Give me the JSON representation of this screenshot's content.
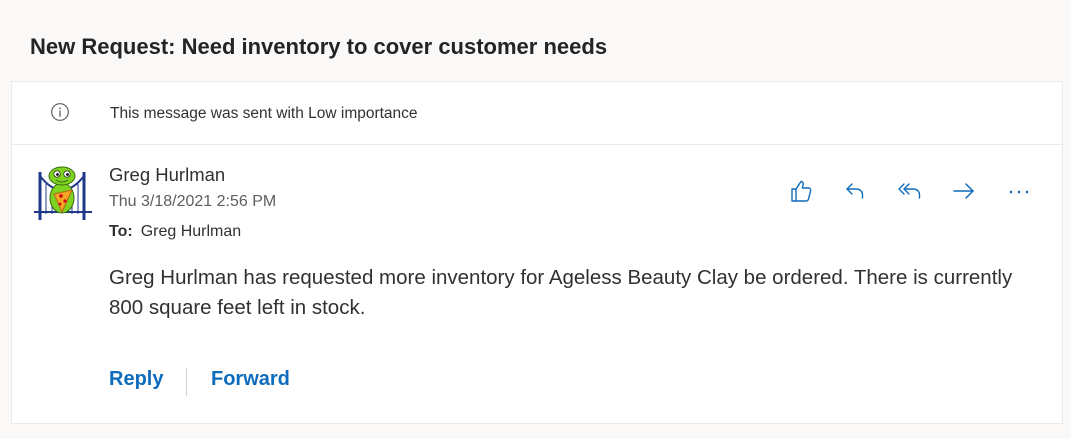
{
  "email": {
    "subject": "New Request: Need inventory to cover customer needs",
    "importance_notice": "This message was sent with Low importance",
    "sender_name": "Greg Hurlman",
    "date": "Thu 3/18/2021 2:56 PM",
    "to_label": "To:",
    "to_value": "Greg Hurlman",
    "body": "Greg Hurlman has requested more inventory for Ageless Beauty Clay be ordered. There is currently 800 square feet left in stock."
  },
  "actions": {
    "icons": [
      "like-icon",
      "reply-icon",
      "reply-all-icon",
      "forward-icon",
      "more-icon"
    ]
  },
  "footer": {
    "reply_label": "Reply",
    "forward_label": "Forward"
  },
  "colors": {
    "accent": "#0f6cbd",
    "background": "#faf9f8",
    "card": "#ffffff"
  }
}
